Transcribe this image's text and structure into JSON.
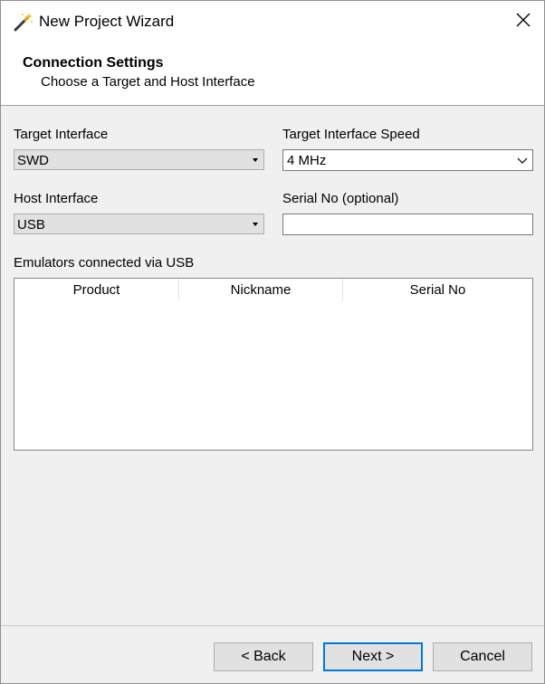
{
  "window": {
    "title": "New Project Wizard"
  },
  "header": {
    "title": "Connection Settings",
    "subtitle": "Choose a Target and Host Interface"
  },
  "form": {
    "target_interface": {
      "label": "Target Interface",
      "value": "SWD"
    },
    "target_speed": {
      "label": "Target Interface Speed",
      "value": "4 MHz"
    },
    "host_interface": {
      "label": "Host Interface",
      "value": "USB"
    },
    "serial_no": {
      "label": "Serial No (optional)",
      "value": ""
    }
  },
  "emulators": {
    "label": "Emulators connected via USB",
    "columns": [
      "Product",
      "Nickname",
      "Serial No"
    ],
    "rows": []
  },
  "buttons": {
    "back": "< Back",
    "next": "Next >",
    "cancel": "Cancel"
  },
  "icons": {
    "app": "magic-wand-icon",
    "close": "close-icon",
    "dropdown": "chevron-down-icon"
  },
  "colors": {
    "accent": "#0078d7",
    "dialog_bg": "#f0f0f0",
    "header_bg": "#ffffff"
  }
}
